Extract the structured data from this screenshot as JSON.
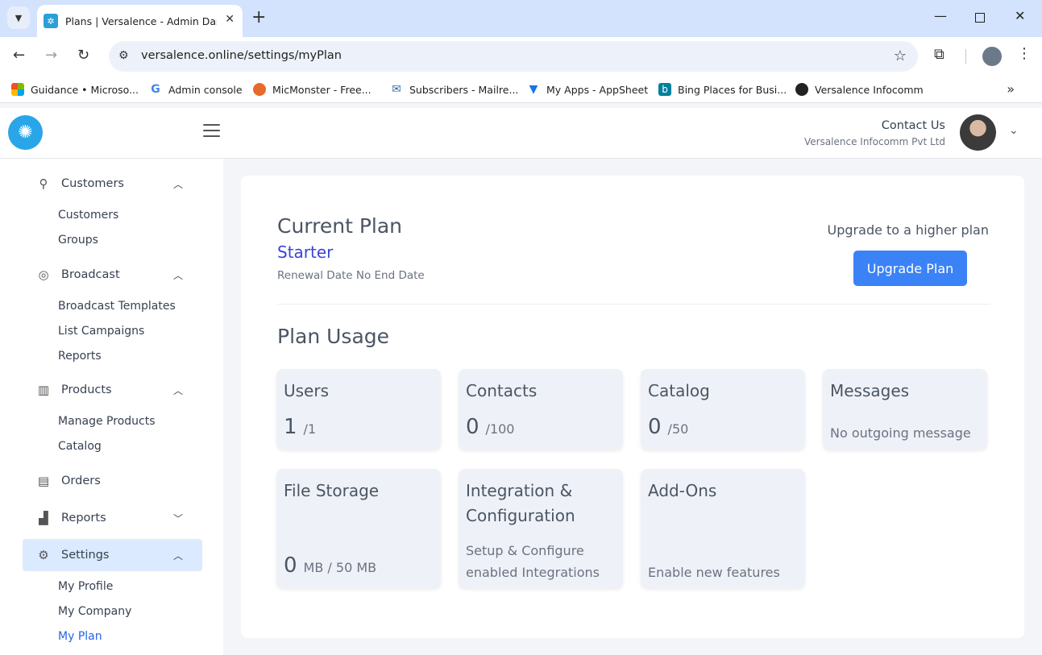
{
  "browser": {
    "tab_title": "Plans | Versalence - Admin Dashboard",
    "url": "versalence.online/settings/myPlan",
    "bookmarks": [
      {
        "label": "Guidance • Microso...",
        "icon": "microsoft-icon",
        "color": "#f25022"
      },
      {
        "label": "Admin console",
        "icon": "google-icon",
        "color": "#4285f4"
      },
      {
        "label": "MicMonster - Free...",
        "icon": "micmonster-icon",
        "color": "#e86a2b"
      },
      {
        "label": "Subscribers - Mailre...",
        "icon": "mail-icon",
        "color": "#2b6cb0"
      },
      {
        "label": "My Apps - AppSheet",
        "icon": "appsheet-icon",
        "color": "#1a73e8"
      },
      {
        "label": "Bing Places for Busi...",
        "icon": "bing-icon",
        "color": "#00809d"
      },
      {
        "label": "Versalence Infocomm",
        "icon": "github-icon",
        "color": "#222222"
      }
    ]
  },
  "header": {
    "contact_title": "Contact Us",
    "company": "Versalence Infocomm Pvt Ltd"
  },
  "sidebar": {
    "groups": [
      {
        "label": "Customers",
        "icon": "customers-icon",
        "expanded": true,
        "items": [
          "Customers",
          "Groups"
        ]
      },
      {
        "label": "Broadcast",
        "icon": "broadcast-icon",
        "expanded": true,
        "items": [
          "Broadcast Templates",
          "List Campaigns",
          "Reports"
        ]
      },
      {
        "label": "Products",
        "icon": "products-icon",
        "expanded": true,
        "items": [
          "Manage Products",
          "Catalog"
        ]
      },
      {
        "label": "Orders",
        "icon": "orders-icon",
        "expanded": false,
        "items": []
      },
      {
        "label": "Reports",
        "icon": "reports-icon",
        "expanded": false,
        "items": []
      },
      {
        "label": "Settings",
        "icon": "settings-icon",
        "expanded": true,
        "items": [
          "My Profile",
          "My Company",
          "My Plan"
        ]
      }
    ],
    "active_item": "My Plan"
  },
  "plan": {
    "title": "Current Plan",
    "name": "Starter",
    "renewal": "Renewal Date No End Date",
    "upgrade_text": "Upgrade to a higher plan",
    "upgrade_button": "Upgrade Plan"
  },
  "usage": {
    "title": "Plan Usage",
    "tiles": [
      {
        "title": "Users",
        "value": "1",
        "limit": "/1"
      },
      {
        "title": "Contacts",
        "value": "0",
        "limit": "/100"
      },
      {
        "title": "Catalog",
        "value": "0",
        "limit": "/50"
      },
      {
        "title": "Messages",
        "text": "No outgoing message"
      },
      {
        "title": "File Storage",
        "value": "0",
        "limit": "MB / 50 MB"
      },
      {
        "title": "Integration &",
        "title2": "Configuration",
        "text": "Setup & Configure",
        "text2": "enabled Integrations"
      },
      {
        "title": "Add-Ons",
        "text": "Enable new features"
      }
    ]
  },
  "colors": {
    "accent": "#3b82f6",
    "plan_name": "#3b43d6",
    "active_nav_bg": "#dbeafe",
    "tile_bg": "#eef2f8"
  }
}
